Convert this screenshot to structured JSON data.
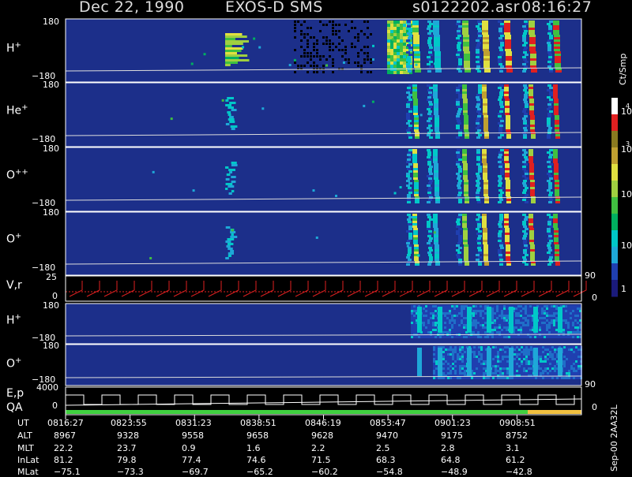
{
  "header": {
    "date": "Dec 22, 1990",
    "instrument": "EXOS-D SMS",
    "file": "s0122202.asr",
    "time": "08:16:27"
  },
  "colorbar": {
    "unit": "Ct/Smp",
    "ticks": [
      "1",
      "10",
      "100",
      "10",
      "10",
      "3",
      "4"
    ],
    "tick_values": [
      1,
      10,
      100,
      1000,
      10000
    ],
    "colors": [
      "#1a1a7a",
      "#1f3fb0",
      "#1ea8d8",
      "#00c8c8",
      "#00b060",
      "#40c040",
      "#a0d040",
      "#e0e040",
      "#c0a030",
      "#8a7a20",
      "#e02020",
      "#ffffff"
    ]
  },
  "panels": [
    {
      "id": "H+ top",
      "label": "H",
      "sup": "+",
      "ymax": "180",
      "ymin": "−180",
      "type": "spectrogram"
    },
    {
      "id": "He+",
      "label": "He",
      "sup": "+",
      "ymax": "180",
      "ymin": "−180",
      "type": "spectrogram"
    },
    {
      "id": "O++",
      "label": "O",
      "sup": "++",
      "ymax": "180",
      "ymin": "−180",
      "type": "spectrogram"
    },
    {
      "id": "O+ top",
      "label": "O",
      "sup": "+",
      "ymax": "180",
      "ymin": "−180",
      "type": "spectrogram"
    },
    {
      "id": "V,r",
      "label": "V,r",
      "ymax": "25",
      "ymin": "0",
      "right": "90",
      "right2": "0",
      "type": "sawtooth"
    },
    {
      "id": "H+ low",
      "label": "H",
      "sup": "+",
      "ymax": "180",
      "ymin": "−180",
      "type": "spectrogram"
    },
    {
      "id": "O+ low",
      "label": "O",
      "sup": "+",
      "ymax": "180",
      "ymin": "−180",
      "type": "spectrogram"
    },
    {
      "id": "E,p QA",
      "label": "E,p",
      "label2": "QA",
      "ymax": "4000",
      "ymin": "0",
      "right": "90",
      "right2": "0",
      "type": "steps"
    }
  ],
  "footer_side": "Sep-00 2AA32L",
  "orbit_table": {
    "row_labels": [
      "UT",
      "ALT",
      "MLT",
      "InLat",
      "MLat"
    ],
    "columns": [
      [
        "0816:27",
        "8967",
        "22.2",
        "81.2",
        "−75.1"
      ],
      [
        "0823:55",
        "9328",
        "23.7",
        "79.8",
        "−73.3"
      ],
      [
        "0831:23",
        "9558",
        "0.9",
        "77.4",
        "−69.7"
      ],
      [
        "0838:51",
        "9658",
        "1.6",
        "74.6",
        "−65.2"
      ],
      [
        "0846:19",
        "9628",
        "2.2",
        "71.5",
        "−60.2"
      ],
      [
        "0853:47",
        "9470",
        "2.5",
        "68.3",
        "−54.8"
      ],
      [
        "0901:23",
        "9175",
        "2.8",
        "64.8",
        "−48.9"
      ],
      [
        "0908:51",
        "8752",
        "3.1",
        "61.2",
        "−42.8"
      ]
    ]
  },
  "chart_data": {
    "type": "heatmap",
    "title": "Dec 22, 1990   EXOS-D SMS",
    "x_ticks_ut": [
      "0816:27",
      "0823:55",
      "0831:23",
      "0838:51",
      "0846:19",
      "0853:47",
      "0901:23",
      "0908:51"
    ],
    "y_range_pitch": [
      -180,
      180
    ],
    "color_scale": "log",
    "color_range": [
      1,
      10000
    ],
    "color_unit": "Ct/Smp",
    "vr_range": [
      0,
      25
    ],
    "ep_range": [
      0,
      4000
    ]
  }
}
